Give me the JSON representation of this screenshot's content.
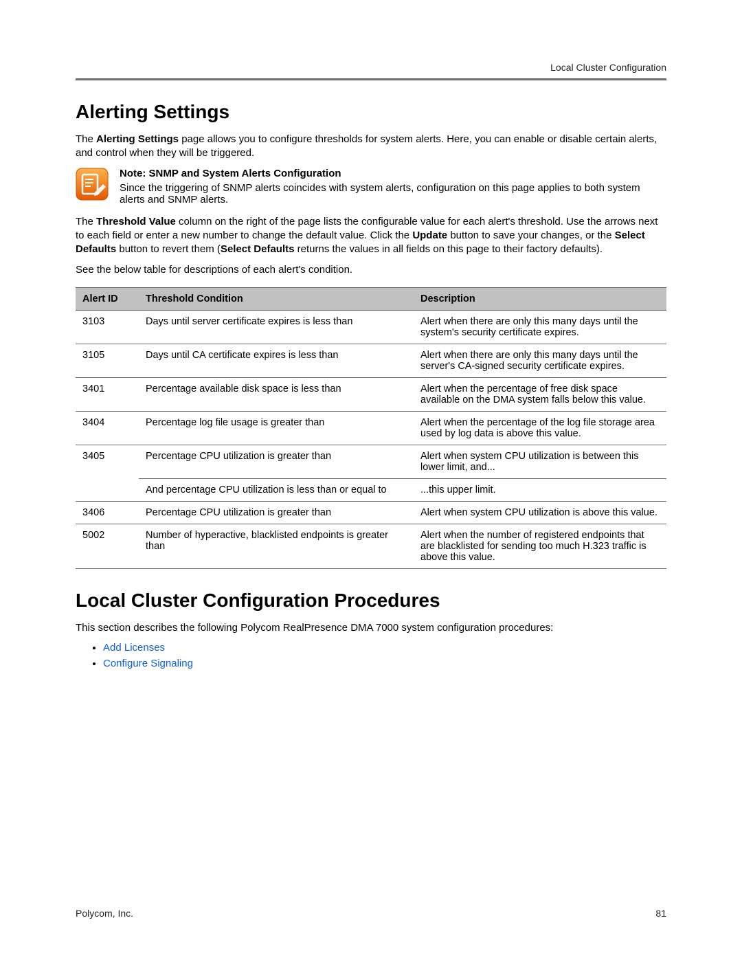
{
  "header": {
    "label": "Local Cluster Configuration"
  },
  "section1": {
    "title": "Alerting Settings",
    "intro_pre": "The ",
    "intro_bold": "Alerting Settings",
    "intro_post": " page allows you to configure thresholds for system alerts. Here, you can enable or disable certain alerts, and control when they will be triggered."
  },
  "note": {
    "title": "Note: SNMP and System Alerts Configuration",
    "body": "Since the triggering of SNMP alerts coincides with system alerts, configuration on this page applies to both system alerts and SNMP alerts."
  },
  "para2": {
    "p1": "The ",
    "b1": "Threshold Value",
    "p2": " column on the right of the page lists the configurable value for each alert's threshold. Use the arrows next to each field or enter a new number to change the default value. Click the ",
    "b2": "Update",
    "p3": " button to save your changes, or the ",
    "b3": "Select Defaults",
    "p4": " button to revert them (",
    "b4": "Select Defaults",
    "p5": " returns the values in all fields on this page to their factory defaults)."
  },
  "para3": "See the below table for descriptions of each alert's condition.",
  "table": {
    "headers": [
      "Alert ID",
      "Threshold Condition",
      "Description"
    ],
    "rows": [
      {
        "id": "3103",
        "cond": "Days until server certificate expires is less than",
        "desc": "Alert when there are only this many days until the system's security certificate expires."
      },
      {
        "id": "3105",
        "cond": "Days until CA certificate expires is less than",
        "desc": "Alert when there are only this many days until the server's CA-signed security certificate expires."
      },
      {
        "id": "3401",
        "cond": "Percentage available disk space is less than",
        "desc": "Alert when the percentage of free disk space available on the DMA system falls below this value."
      },
      {
        "id": "3404",
        "cond": "Percentage log file usage is greater than",
        "desc": "Alert when the percentage of the log file storage area used by log data is above this value."
      },
      {
        "id": "3405",
        "cond": "Percentage CPU utilization is greater than",
        "desc": "Alert when system CPU utilization is between this lower limit, and..."
      },
      {
        "id": "",
        "cond": "And percentage CPU utilization is less than or equal to",
        "desc": "...this upper limit."
      },
      {
        "id": "3406",
        "cond": "Percentage CPU utilization is greater than",
        "desc": "Alert when system CPU utilization is above this value."
      },
      {
        "id": "5002",
        "cond": "Number of hyperactive, blacklisted endpoints is greater than",
        "desc": "Alert when the number of registered endpoints that are blacklisted for sending too much H.323 traffic is above this value."
      }
    ]
  },
  "section2": {
    "title": "Local Cluster Configuration Procedures",
    "intro": "This section describes the following Polycom RealPresence DMA 7000 system configuration procedures:",
    "links": [
      "Add Licenses",
      "Configure Signaling"
    ]
  },
  "footer": {
    "left": "Polycom, Inc.",
    "right": "81"
  }
}
